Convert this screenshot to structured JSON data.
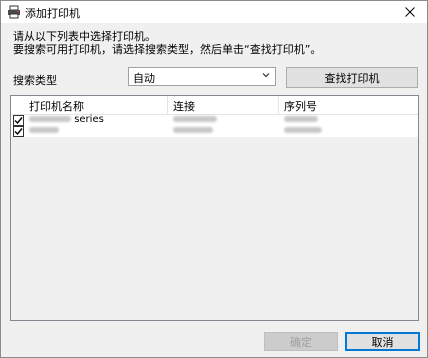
{
  "window": {
    "title": "添加打印机",
    "close_glyph": "✕"
  },
  "instructions": {
    "line1": "请从以下列表中选择打印机。",
    "line2": "要搜索可用打印机，请选择搜索类型，然后单击“查找打印机”。"
  },
  "search": {
    "type_label": "搜索类型",
    "type_value": "自动",
    "find_button": "查找打印机"
  },
  "table": {
    "columns": [
      "打印机名称",
      "连接",
      "序列号"
    ],
    "rows": [
      {
        "checked": true,
        "name": "series"
      },
      {
        "checked": true,
        "name": ""
      }
    ]
  },
  "footer": {
    "ok_label": "确定",
    "cancel_label": "取消"
  },
  "colors": {
    "accent": "#0078d7",
    "list_border": "#828790"
  }
}
